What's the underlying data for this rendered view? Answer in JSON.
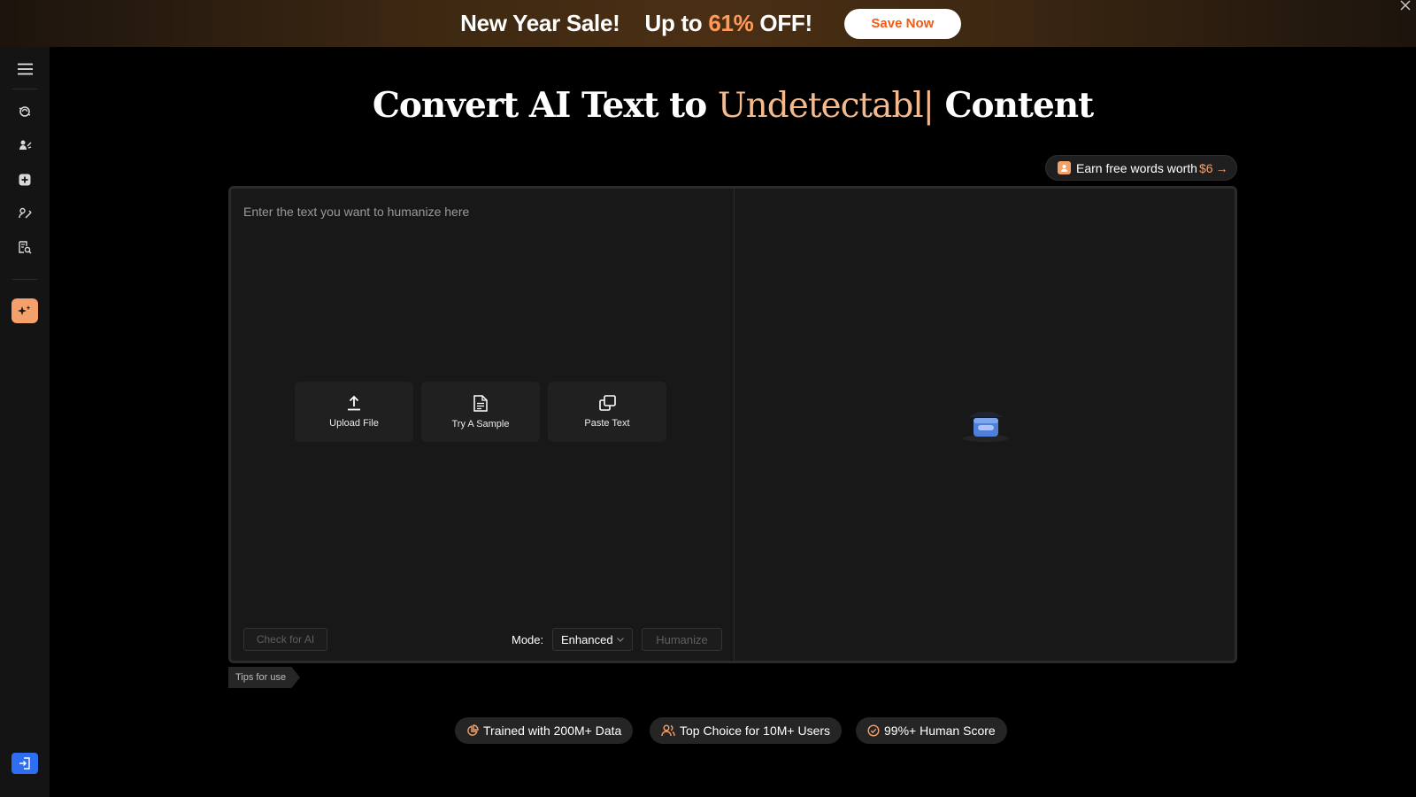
{
  "banner": {
    "sale_text": "New Year Sale!",
    "offer_prefix": "Up to ",
    "offer_percent": "61%",
    "offer_suffix": " OFF!",
    "save_button": "Save Now",
    "close_icon": "close-icon"
  },
  "sidebar": {
    "icons": [
      "menu-icon",
      "humanizer-icon",
      "rewrite-icon",
      "add-icon",
      "paraphrase-icon",
      "detector-icon",
      "ai-sparkle-icon",
      "login-icon"
    ],
    "accent_color": "#f4a06b",
    "login_color": "#2d6ff0"
  },
  "title": {
    "prefix": "Convert AI Text to ",
    "highlight": "Undetectabl",
    "caret": "|",
    "suffix": " Content"
  },
  "earn": {
    "text": "Earn free words worth ",
    "amount": "$6",
    "arrow": "→"
  },
  "editor": {
    "placeholder": "Enter the text you want to humanize here",
    "actions": [
      {
        "label": "Upload File",
        "icon": "upload-icon"
      },
      {
        "label": "Try A Sample",
        "icon": "document-icon"
      },
      {
        "label": "Paste Text",
        "icon": "paste-icon"
      }
    ],
    "check_button": "Check for AI",
    "mode_label": "Mode:",
    "mode_value": "Enhanced",
    "humanize_button": "Humanize"
  },
  "tips": "Tips for use",
  "badges": [
    {
      "label": "Trained with 200M+ Data",
      "icon": "chart-pie-icon"
    },
    {
      "label": "Top Choice for 10M+ Users",
      "icon": "users-icon"
    },
    {
      "label": "99%+ Human Score",
      "icon": "check-circle-icon"
    }
  ]
}
